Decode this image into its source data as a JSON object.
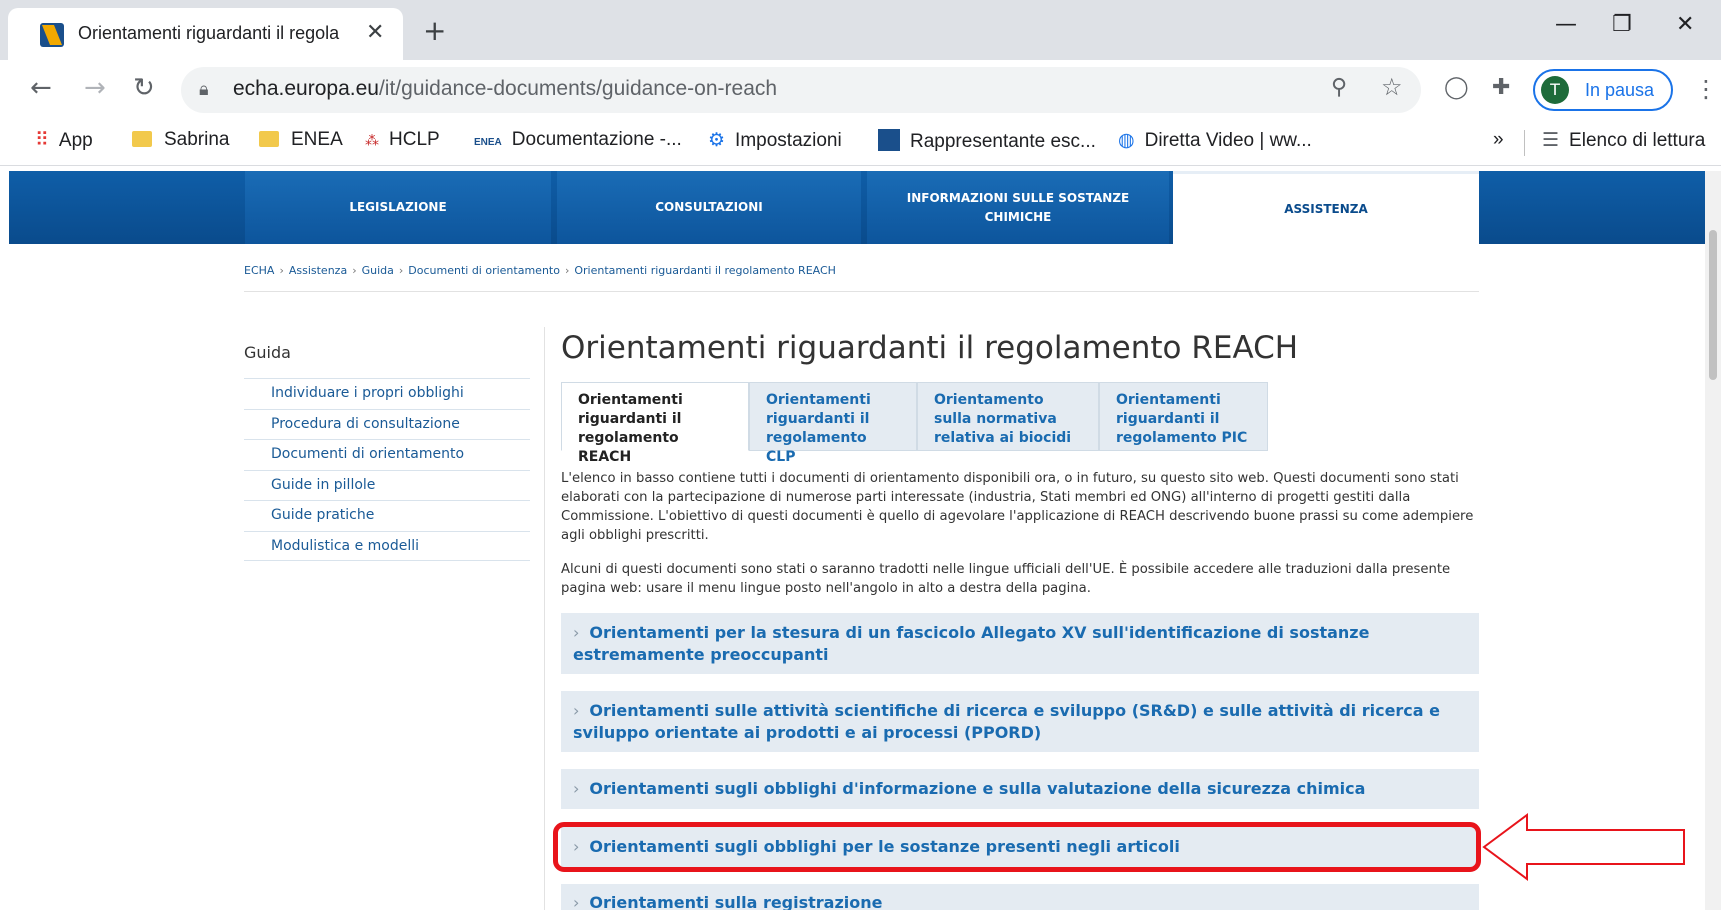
{
  "browser": {
    "tab_title": "Orientamenti riguardanti il regola",
    "tab_close": "✕",
    "new_tab": "+",
    "url_domain": "echa.europa.eu",
    "url_path": "/it/guidance-documents/guidance-on-reach",
    "profile_initial": "T",
    "profile_label": "In pausa",
    "bookmarks": [
      {
        "label": "App"
      },
      {
        "label": "Sabrina"
      },
      {
        "label": "ENEA"
      },
      {
        "label": "HCLP"
      },
      {
        "label": "Documentazione -..."
      },
      {
        "label": "Impostazioni"
      },
      {
        "label": "Rappresentante esc..."
      },
      {
        "label": "Diretta Video | ww..."
      }
    ],
    "bookmarks_more": "»",
    "reading_list": "Elenco di lettura"
  },
  "site_nav": [
    {
      "label": "LEGISLAZIONE"
    },
    {
      "label": "CONSULTAZIONI"
    },
    {
      "label": "INFORMAZIONI SULLE SOSTANZE CHIMICHE"
    },
    {
      "label": "ASSISTENZA"
    }
  ],
  "breadcrumb": [
    "ECHA",
    "Assistenza",
    "Guida",
    "Documenti di orientamento",
    "Orientamenti riguardanti il regolamento REACH"
  ],
  "sidebar": {
    "title": "Guida",
    "items": [
      {
        "label": "Individuare i propri obblighi"
      },
      {
        "label": "Procedura di consultazione"
      },
      {
        "label": "Documenti di orientamento"
      },
      {
        "label": "Guide in pillole"
      },
      {
        "label": "Guide pratiche"
      },
      {
        "label": "Modulistica e modelli"
      }
    ]
  },
  "main": {
    "title": "Orientamenti riguardanti il regolamento REACH",
    "tabs": [
      {
        "label": "Orientamenti riguardanti il regolamento REACH"
      },
      {
        "label": "Orientamenti riguardanti il regolamento CLP"
      },
      {
        "label": "Orientamento sulla normativa relativa ai biocidi"
      },
      {
        "label": "Orientamenti riguardanti il regolamento PIC"
      }
    ],
    "paragraph1": "L'elenco in basso contiene tutti i documenti di orientamento disponibili ora, o in futuro, su questo sito web. Questi documenti sono stati elaborati con la partecipazione di numerose parti interessate (industria, Stati membri ed ONG) all'interno di progetti gestiti dalla Commissione. L'obiettivo di questi documenti è quello di agevolare l'applicazione di REACH descrivendo buone prassi su come adempiere agli obblighi prescritti.",
    "paragraph2": "Alcuni di questi documenti sono stati o saranno tradotti nelle lingue ufficiali dell'UE. È possibile accedere alle traduzioni dalla presente pagina web: usare il menu lingue posto nell'angolo in alto a destra della pagina.",
    "accordions": [
      {
        "label": "Orientamenti per la stesura di un fascicolo Allegato XV sull'identificazione di sostanze estremamente preoccupanti"
      },
      {
        "label": "Orientamenti sulle attività scientifiche di ricerca e sviluppo (SR&D) e sulle attività di ricerca e sviluppo orientate ai prodotti e ai processi (PPORD)"
      },
      {
        "label": "Orientamenti sugli obblighi d'informazione e sulla valutazione della sicurezza chimica"
      },
      {
        "label": "Orientamenti sugli obblighi per le sostanze presenti negli articoli"
      },
      {
        "label": "Orientamenti sulla registrazione"
      }
    ],
    "chevron": "›"
  },
  "annotation": {
    "highlight_color": "#e8141b"
  }
}
